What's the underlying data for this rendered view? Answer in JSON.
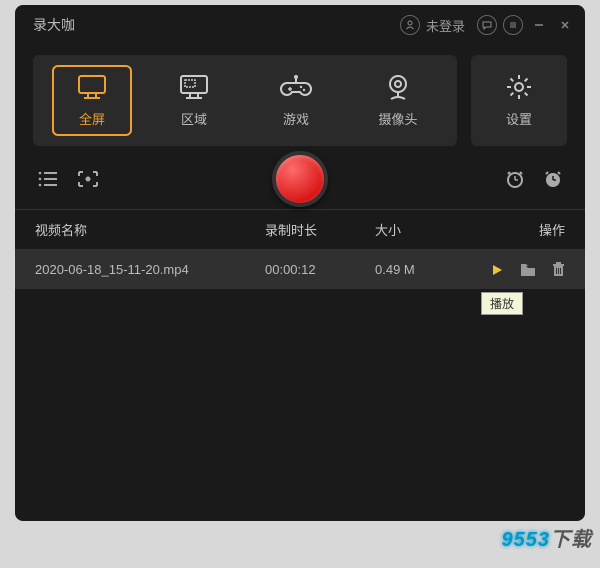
{
  "header": {
    "title": "录大咖",
    "login_status": "未登录"
  },
  "modes": {
    "fullscreen": "全屏",
    "region": "区域",
    "game": "游戏",
    "camera": "摄像头",
    "settings": "设置"
  },
  "table": {
    "headers": {
      "name": "视频名称",
      "duration": "录制时长",
      "size": "大小",
      "actions": "操作"
    },
    "rows": [
      {
        "name": "2020-06-18_15-11-20.mp4",
        "duration": "00:00:12",
        "size": "0.49 M"
      }
    ]
  },
  "tooltip": "播放",
  "watermark": "9553下载"
}
